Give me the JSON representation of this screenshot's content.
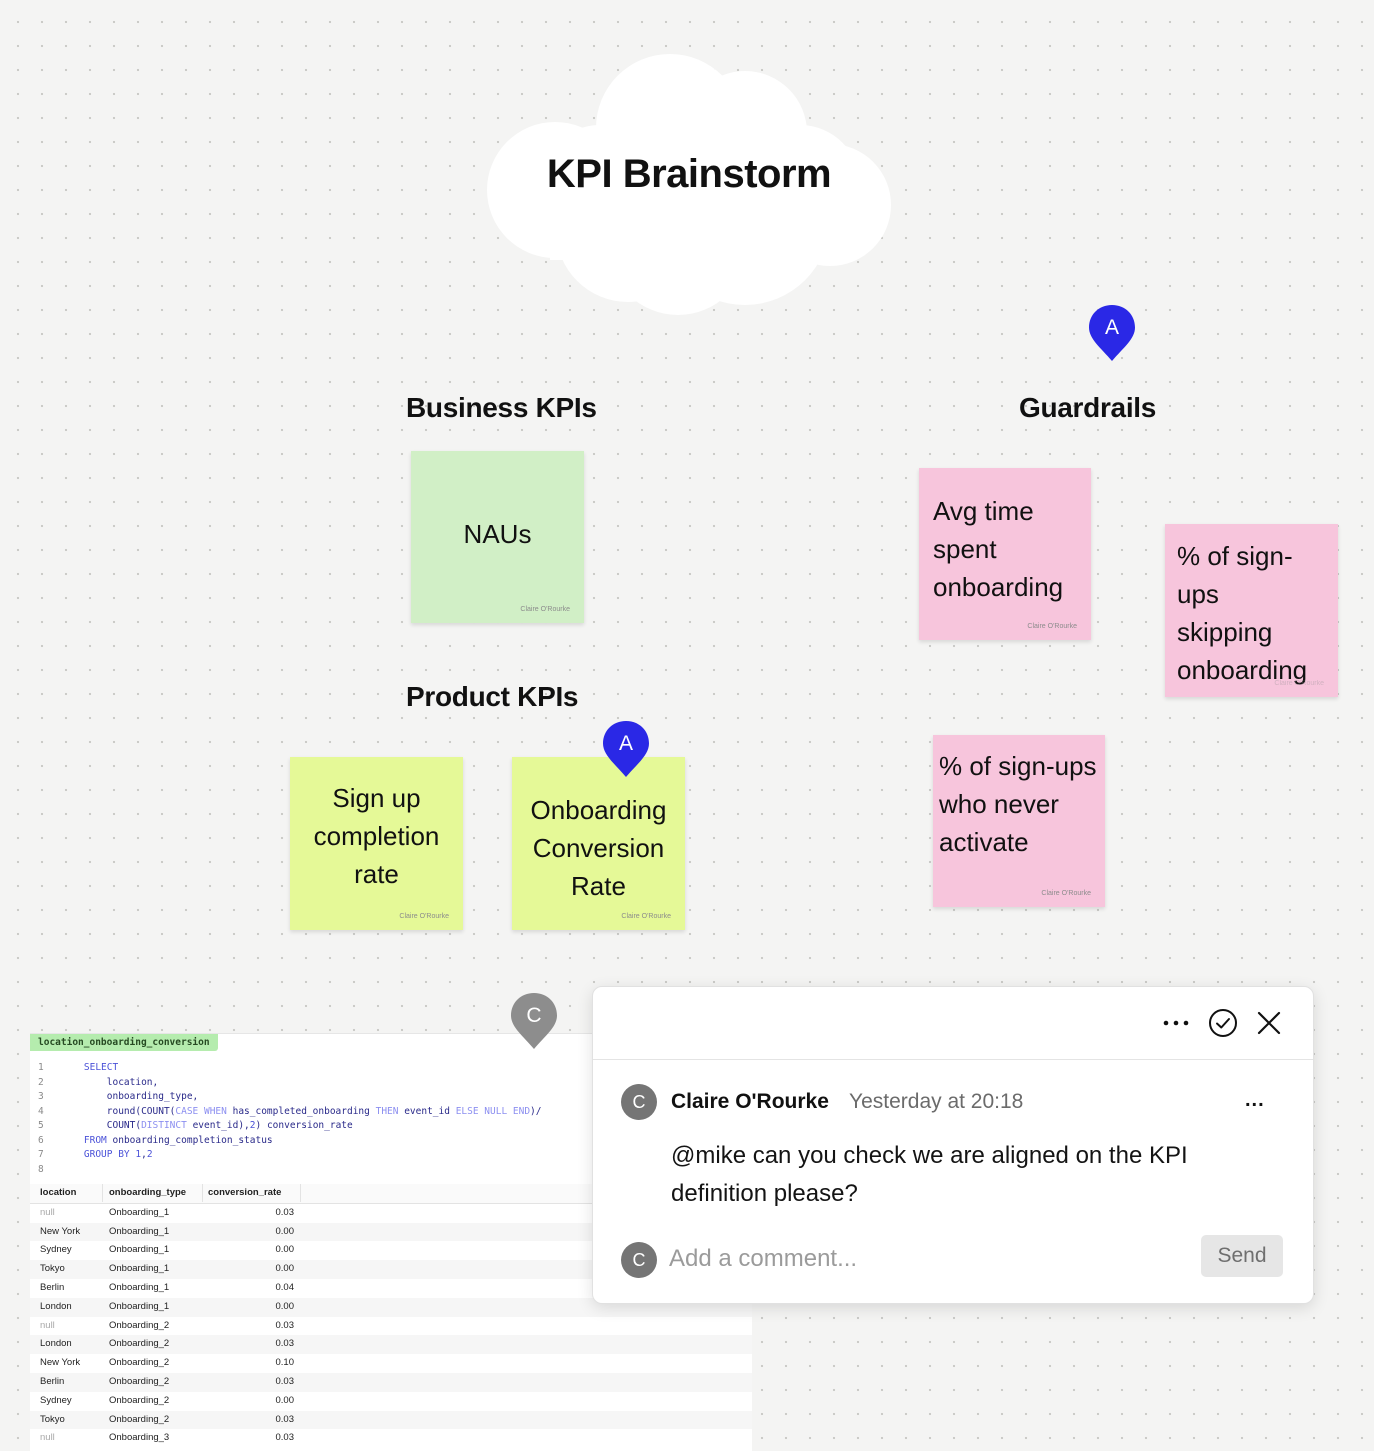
{
  "board": {
    "title": "KPI Brainstorm",
    "sections": {
      "business": "Business KPIs",
      "product": "Product KPIs",
      "guardrails": "Guardrails"
    }
  },
  "stickies": {
    "naus": {
      "lines": [
        "NAUs"
      ],
      "author": "Claire O'Rourke"
    },
    "signup": {
      "lines": [
        "Sign up",
        "completion",
        "rate"
      ],
      "author": "Claire O'Rourke"
    },
    "onboarding_conv": {
      "lines": [
        "Onboarding",
        "Conversion",
        "Rate"
      ],
      "author": "Claire O'Rourke"
    },
    "avg_time": {
      "lines": [
        "Avg time",
        "spent",
        "onboarding"
      ],
      "author": "Claire O'Rourke"
    },
    "skipping": {
      "lines": [
        "% of sign-",
        "ups",
        "skipping",
        "onboarding"
      ],
      "author": "Claire O'Rourke"
    },
    "never_activate": {
      "lines": [
        "% of sign-ups",
        "who never",
        "activate"
      ],
      "author": "Claire O'Rourke"
    }
  },
  "pins": {
    "guardrails_pin": "A",
    "product_pin": "A",
    "sql_pin": "C"
  },
  "colors": {
    "pin_blue": "#2a28e6",
    "pin_grey": "#8d8d8d",
    "sticky_green": "#d1efc6",
    "sticky_lime": "#e5f997",
    "sticky_pink": "#f7c5dc"
  },
  "sql_cell": {
    "name": "location_onboarding_conversion",
    "code": [
      {
        "n": "1",
        "parts": [
          {
            "t": "    "
          },
          {
            "t": "SELECT",
            "c": "kw"
          }
        ]
      },
      {
        "n": "2",
        "parts": [
          {
            "t": "        location,"
          }
        ]
      },
      {
        "n": "3",
        "parts": [
          {
            "t": "        onboarding_type,"
          }
        ]
      },
      {
        "n": "4",
        "parts": [
          {
            "t": "        round(COUNT("
          },
          {
            "t": "CASE WHEN",
            "c": "dim"
          },
          {
            "t": " has_completed_onboarding "
          },
          {
            "t": "THEN",
            "c": "dim"
          },
          {
            "t": " event_id "
          },
          {
            "t": "ELSE NULL END",
            "c": "dim"
          },
          {
            "t": ")/"
          }
        ]
      },
      {
        "n": "5",
        "parts": [
          {
            "t": "        COUNT("
          },
          {
            "t": "DISTINCT",
            "c": "dim"
          },
          {
            "t": " event_id),"
          },
          {
            "t": "2",
            "c": "kw"
          },
          {
            "t": ") conversion_rate"
          }
        ]
      },
      {
        "n": "6",
        "parts": [
          {
            "t": "    "
          },
          {
            "t": "FROM",
            "c": "kw"
          },
          {
            "t": " onboarding_completion_status"
          }
        ]
      },
      {
        "n": "7",
        "parts": [
          {
            "t": "    "
          },
          {
            "t": "GROUP BY",
            "c": "kw"
          },
          {
            "t": " "
          },
          {
            "t": "1",
            "c": "kw"
          },
          {
            "t": ","
          },
          {
            "t": "2",
            "c": "kw"
          }
        ]
      },
      {
        "n": "8",
        "parts": []
      }
    ],
    "columns": [
      "location",
      "onboarding_type",
      "conversion_rate"
    ],
    "rows": [
      [
        "null",
        "Onboarding_1",
        "0.03"
      ],
      [
        "New York",
        "Onboarding_1",
        "0.00"
      ],
      [
        "Sydney",
        "Onboarding_1",
        "0.00"
      ],
      [
        "Tokyo",
        "Onboarding_1",
        "0.00"
      ],
      [
        "Berlin",
        "Onboarding_1",
        "0.04"
      ],
      [
        "London",
        "Onboarding_1",
        "0.00"
      ],
      [
        "null",
        "Onboarding_2",
        "0.03"
      ],
      [
        "London",
        "Onboarding_2",
        "0.03"
      ],
      [
        "New York",
        "Onboarding_2",
        "0.10"
      ],
      [
        "Berlin",
        "Onboarding_2",
        "0.03"
      ],
      [
        "Sydney",
        "Onboarding_2",
        "0.00"
      ],
      [
        "Tokyo",
        "Onboarding_2",
        "0.03"
      ],
      [
        "null",
        "Onboarding_3",
        "0.03"
      ]
    ]
  },
  "comment": {
    "author": "Claire O'Rourke",
    "time": "Yesterday at 20:18",
    "avatar_letter": "C",
    "body": "@mike can you check we are aligned on the KPI definition please?",
    "more_label": "...",
    "reply_avatar_letter": "C",
    "input_placeholder": "Add a comment...",
    "input_value": "",
    "send_label": "Send"
  }
}
